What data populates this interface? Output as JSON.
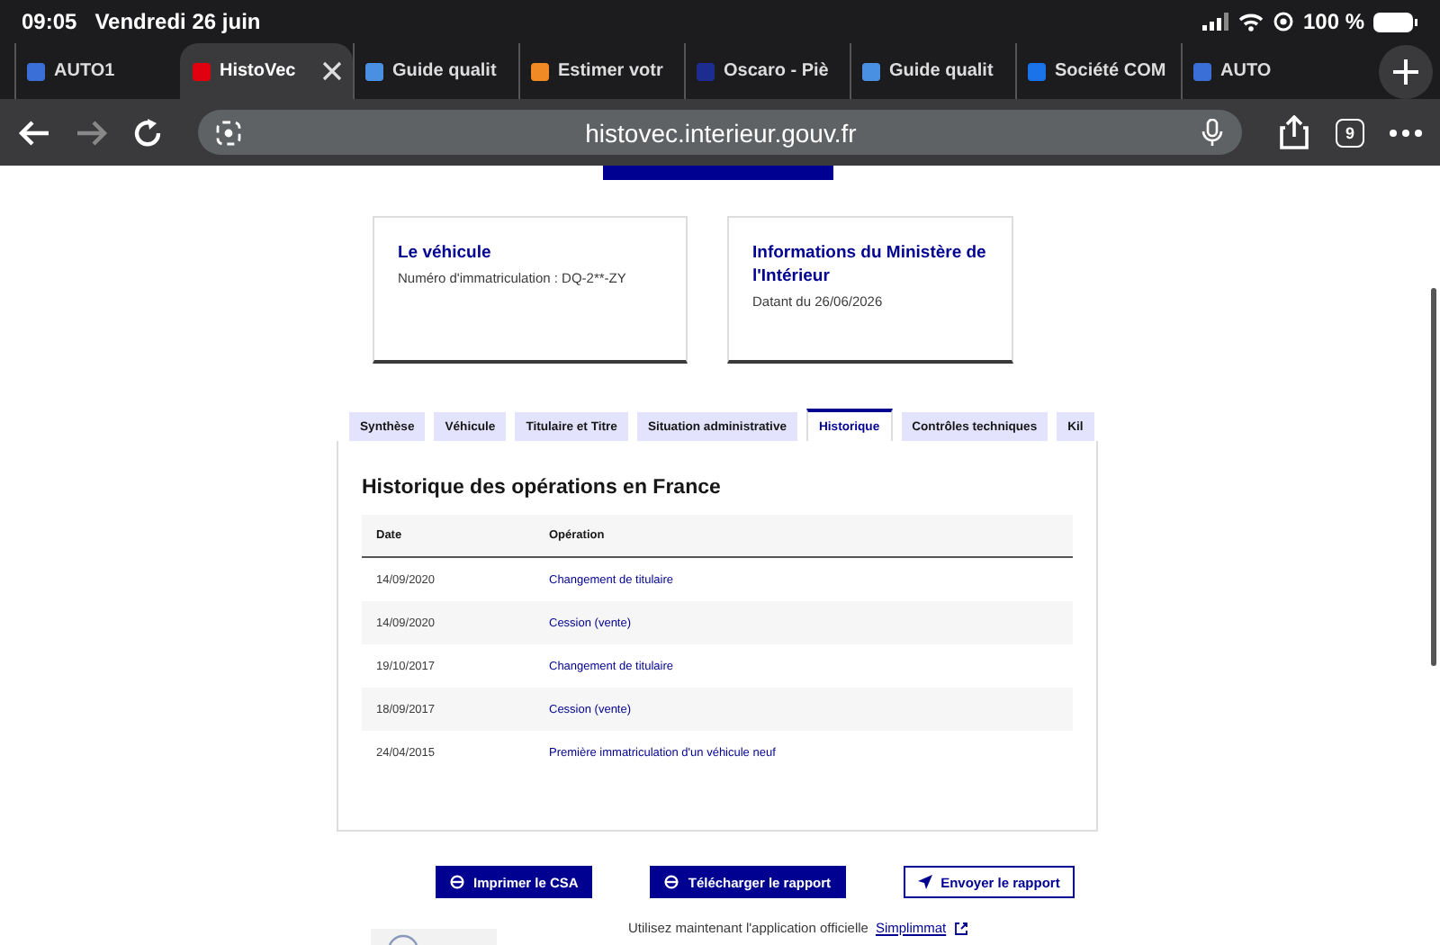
{
  "status_bar": {
    "time": "09:05",
    "date": "Vendredi 26 juin",
    "battery": "100 %"
  },
  "browser_tabs": [
    {
      "title": "AUTO1",
      "selected": false,
      "color": "#3b6fd8"
    },
    {
      "title": "HistoVec",
      "selected": true,
      "color": "#e1000f"
    },
    {
      "title": "Guide qualit",
      "selected": false,
      "color": "#4a90e2"
    },
    {
      "title": "Estimer votr",
      "selected": false,
      "color": "#f08a24"
    },
    {
      "title": "Oscaro - Piè",
      "selected": false,
      "color": "#1d2c8f"
    },
    {
      "title": "Guide qualit",
      "selected": false,
      "color": "#4a90e2"
    },
    {
      "title": "Société COM",
      "selected": false,
      "color": "#1a73e8"
    },
    {
      "title": "AUTO",
      "selected": false,
      "color": "#3b6fd8"
    }
  ],
  "toolbar": {
    "address": "histovec.interieur.gouv.fr",
    "tab_count": "9"
  },
  "cards": [
    {
      "title": "Le véhicule",
      "text": "Numéro d'immatriculation : DQ-2**-ZY"
    },
    {
      "title": "Informations du Ministère de l'Intérieur",
      "text": "Datant du 26/06/2026"
    }
  ],
  "page_tabs": [
    {
      "label": "Synthèse",
      "selected": false
    },
    {
      "label": "Véhicule",
      "selected": false
    },
    {
      "label": "Titulaire et Titre",
      "selected": false
    },
    {
      "label": "Situation administrative",
      "selected": false
    },
    {
      "label": "Historique",
      "selected": true
    },
    {
      "label": "Contrôles techniques",
      "selected": false
    },
    {
      "label": "Kil",
      "selected": false
    }
  ],
  "section_title": "Historique des opérations en France",
  "table": {
    "columns": [
      "Date",
      "Opération"
    ],
    "rows": [
      {
        "date": "14/09/2020",
        "operation": "Changement de titulaire"
      },
      {
        "date": "14/09/2020",
        "operation": "Cession (vente)"
      },
      {
        "date": "19/10/2017",
        "operation": "Changement de titulaire"
      },
      {
        "date": "18/09/2017",
        "operation": "Cession (vente)"
      },
      {
        "date": "24/04/2015",
        "operation": "Première immatriculation d'un véhicule neuf"
      }
    ]
  },
  "buttons": [
    {
      "label": "Imprimer le CSA",
      "kind": "primary"
    },
    {
      "label": "Télécharger le rapport",
      "kind": "primary"
    },
    {
      "label": "Envoyer le rapport",
      "kind": "secondary"
    }
  ],
  "footer": {
    "text": "Utilisez maintenant l'application officielle",
    "link": "Simplimmat"
  }
}
